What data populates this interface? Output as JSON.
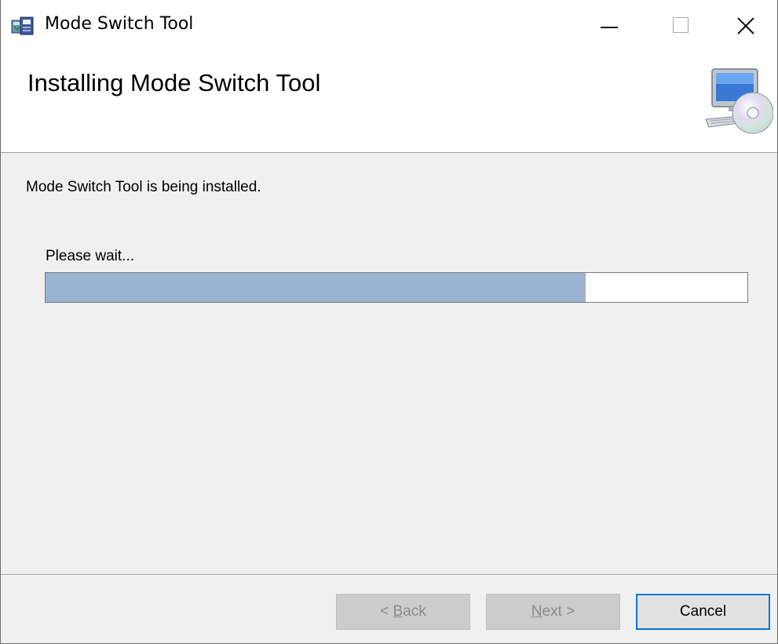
{
  "window": {
    "title": "Mode Switch Tool",
    "icon": "installer-package-icon"
  },
  "title_bar_buttons": {
    "minimize": "minimize-icon",
    "maximize": "maximize-icon",
    "close": "close-icon"
  },
  "header": {
    "title": "Installing Mode Switch Tool",
    "icon": "computer-cd-icon"
  },
  "body": {
    "status": "Mode Switch Tool is being installed.",
    "wait_label": "Please wait...",
    "progress_percent": 77,
    "progress_color": "#9bb3d1"
  },
  "buttons": {
    "back": {
      "prefix": "< ",
      "mnemonic": "B",
      "rest": "ack",
      "enabled": false
    },
    "next": {
      "mnemonic": "N",
      "rest": "ext",
      "suffix": " >",
      "enabled": false
    },
    "cancel": {
      "label": "Cancel",
      "enabled": true,
      "focus_color": "#0078d7"
    }
  }
}
